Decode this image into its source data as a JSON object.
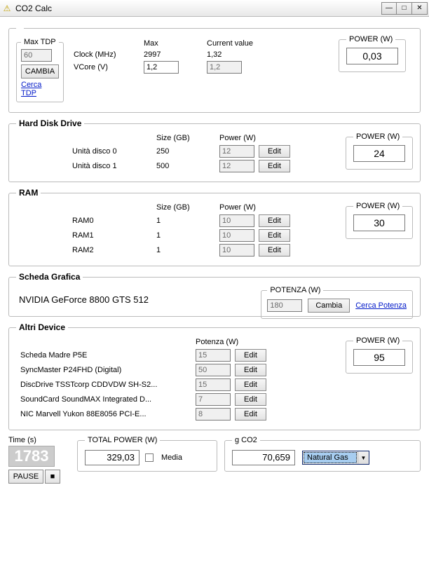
{
  "title": "CO2 Calc",
  "top": {
    "maxtdp_legend": "Max TDP",
    "maxtdp_value": "60",
    "cambia": "CAMBIA",
    "cerca_tdp": "Cerca TDP",
    "col_max": "Max",
    "col_current": "Current value",
    "clock_lbl": "Clock (MHz)",
    "clock_max": "2997",
    "clock_cur": "1,32",
    "vcore_lbl": "VCore (V)",
    "vcore_max": "1,2",
    "vcore_cur": "1,2",
    "power_legend": "POWER (W)",
    "power_val": "0,03"
  },
  "hdd": {
    "legend": "Hard Disk Drive",
    "col_size": "Size (GB)",
    "col_power": "Power (W)",
    "rows": [
      {
        "name": "Unità disco 0",
        "size": "250",
        "power": "12"
      },
      {
        "name": "Unità disco 1",
        "size": "500",
        "power": "12"
      }
    ],
    "edit": "Edit",
    "power_legend": "POWER (W)",
    "power_val": "24"
  },
  "ram": {
    "legend": "RAM",
    "col_size": "Size (GB)",
    "col_power": "Power (W)",
    "rows": [
      {
        "name": "RAM0",
        "size": "1",
        "power": "10"
      },
      {
        "name": "RAM1",
        "size": "1",
        "power": "10"
      },
      {
        "name": "RAM2",
        "size": "1",
        "power": "10"
      }
    ],
    "edit": "Edit",
    "power_legend": "POWER (W)",
    "power_val": "30"
  },
  "gpu": {
    "legend": "Scheda Grafica",
    "name": "NVIDIA GeForce 8800 GTS 512",
    "pot_legend": "POTENZA (W)",
    "pot_val": "180",
    "cambia": "Cambia",
    "cerca": "Cerca Potenza"
  },
  "other": {
    "legend": "Altri Device",
    "col_power": "Potenza (W)",
    "rows": [
      {
        "name": "Scheda Madre P5E",
        "power": "15"
      },
      {
        "name": "SyncMaster P24FHD (Digital)",
        "power": "50"
      },
      {
        "name": "DiscDrive TSSTcorp CDDVDW SH-S2...",
        "power": "15"
      },
      {
        "name": "SoundCard SoundMAX Integrated D...",
        "power": "7"
      },
      {
        "name": "NIC Marvell Yukon 88E8056 PCI-E...",
        "power": "8"
      }
    ],
    "edit": "Edit",
    "power_legend": "POWER (W)",
    "power_val": "95"
  },
  "bottom": {
    "time_lbl": "Time (s)",
    "time_val": "1783",
    "pause": "PAUSE",
    "stop": "■",
    "total_legend": "TOTAL POWER (W)",
    "total_val": "329,03",
    "media": "Media",
    "gco2_legend": "g CO2",
    "gco2_val": "70,659",
    "fuel": "Natural Gas"
  }
}
